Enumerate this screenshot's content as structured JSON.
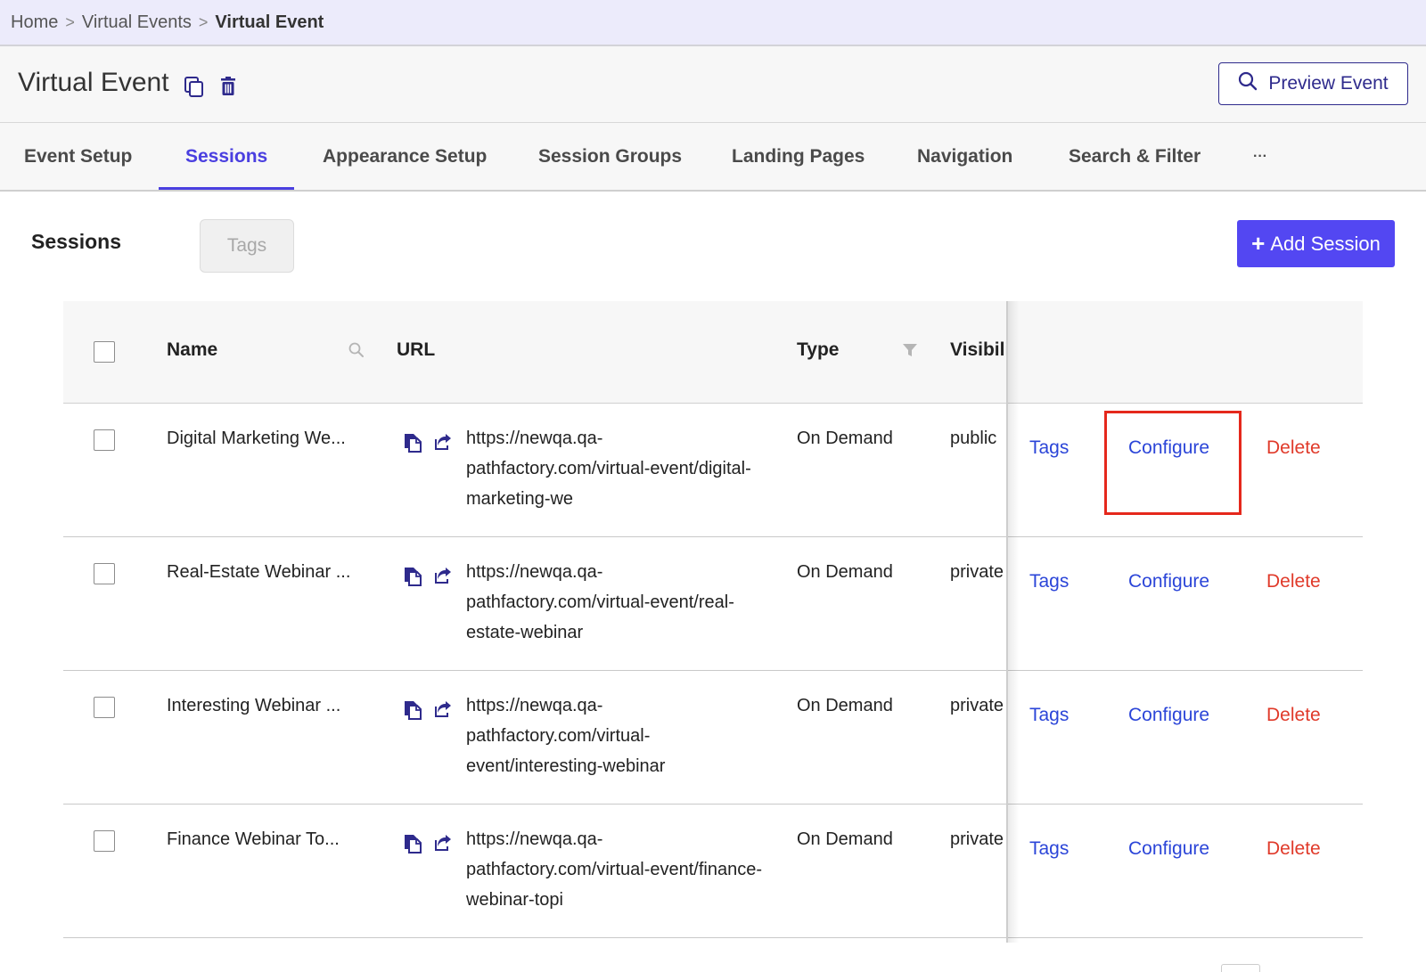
{
  "breadcrumb": {
    "home": "Home",
    "parent": "Virtual Events",
    "current": "Virtual Event",
    "separator": ">"
  },
  "header": {
    "title": "Virtual Event",
    "preview_label": "Preview Event"
  },
  "tabs": [
    {
      "label": "Event Setup"
    },
    {
      "label": "Sessions"
    },
    {
      "label": "Appearance Setup"
    },
    {
      "label": "Session Groups"
    },
    {
      "label": "Landing Pages"
    },
    {
      "label": "Navigation"
    },
    {
      "label": "Search & Filter"
    },
    {
      "label": "···"
    }
  ],
  "active_tab": "Sessions",
  "sessions_section": {
    "title": "Sessions",
    "tags_button": "Tags",
    "add_button": "Add Session"
  },
  "table": {
    "columns": {
      "name": "Name",
      "url": "URL",
      "type": "Type",
      "visibility": "Visibili"
    },
    "rows": [
      {
        "name": "Digital Marketing We...",
        "url": "https://newqa.qa-pathfactory.com/virtual-event/digital-marketing-we",
        "type": "On Demand",
        "visibility": "public",
        "tags": "Tags",
        "configure": "Configure",
        "delete": "Delete"
      },
      {
        "name": "Real-Estate Webinar ...",
        "url": "https://newqa.qa-pathfactory.com/virtual-event/real-estate-webinar",
        "type": "On Demand",
        "visibility": "private",
        "tags": "Tags",
        "configure": "Configure",
        "delete": "Delete"
      },
      {
        "name": "Interesting Webinar ...",
        "url": "https://newqa.qa-pathfactory.com/virtual-event/interesting-webinar",
        "type": "On Demand",
        "visibility": "private",
        "tags": "Tags",
        "configure": "Configure",
        "delete": "Delete"
      },
      {
        "name": "Finance Webinar To...",
        "url": "https://newqa.qa-pathfactory.com/virtual-event/finance-webinar-topi",
        "type": "On Demand",
        "visibility": "private",
        "tags": "Tags",
        "configure": "Configure",
        "delete": "Delete"
      }
    ]
  },
  "colors": {
    "accent": "#4a3fe0",
    "primary_button": "#5347f2",
    "link": "#2b45d8",
    "danger": "#e03a2a",
    "highlight": "#e5281c"
  },
  "icons": {
    "copy": "copy-icon",
    "trash": "trash-icon",
    "search": "search-icon",
    "filter": "filter-icon",
    "open": "open-link-icon"
  }
}
